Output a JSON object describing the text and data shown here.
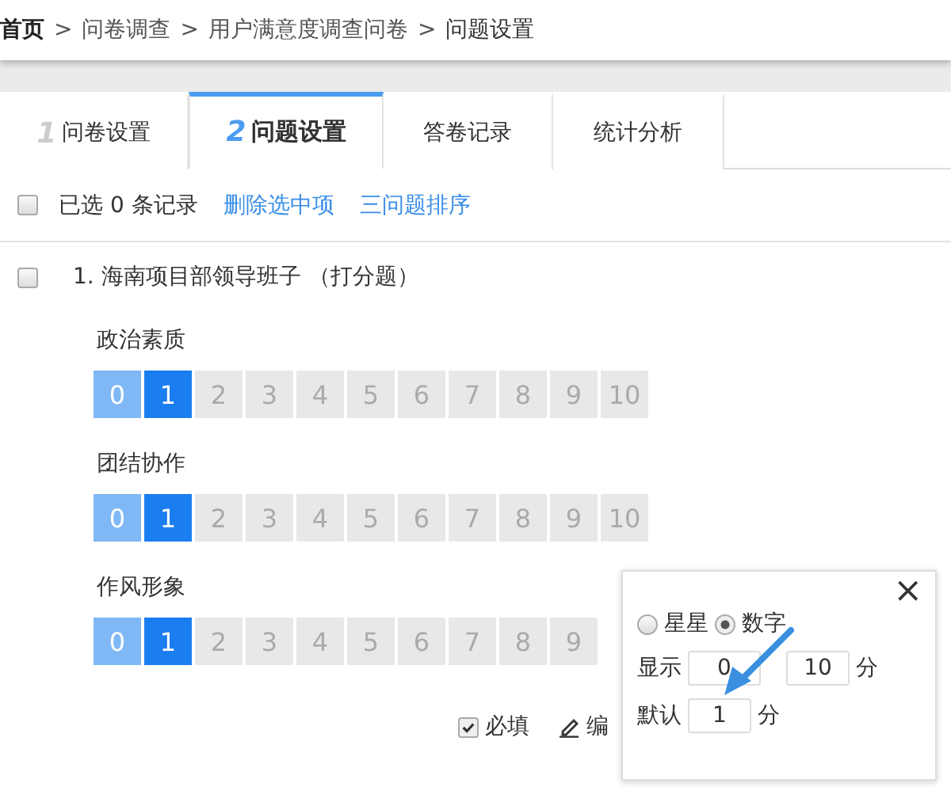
{
  "breadcrumb": [
    {
      "label": "首页",
      "kind": "home"
    },
    {
      "label": "问卷调查",
      "kind": "link"
    },
    {
      "label": "用户满意度调查问卷",
      "kind": "link"
    },
    {
      "label": "问题设置",
      "kind": "current"
    }
  ],
  "breadcrumb_separator": ">",
  "tabs": [
    {
      "number": "1",
      "label": "问卷设置",
      "selected": false
    },
    {
      "number": "2",
      "label": "问题设置",
      "selected": true
    },
    {
      "label": "答卷记录",
      "selected": false
    },
    {
      "label": "统计分析",
      "selected": false
    }
  ],
  "toolbar": {
    "select_all": {
      "checked": false
    },
    "count_text": "已选 0 条记录",
    "delete_link": "删除选中项",
    "sort_link": "三问题排序"
  },
  "question": {
    "checked": false,
    "title": "1. 海南项目部领导班子 （打分题）",
    "items": [
      {
        "label": "政治素质",
        "options": [
          {
            "label": "0",
            "selected": false
          },
          {
            "label": "1",
            "selected": true
          },
          {
            "label": "2",
            "selected": false
          },
          {
            "label": "3",
            "selected": false
          },
          {
            "label": "4",
            "selected": false
          },
          {
            "label": "5",
            "selected": false
          },
          {
            "label": "6",
            "selected": false
          },
          {
            "label": "7",
            "selected": false
          },
          {
            "label": "8",
            "selected": false
          },
          {
            "label": "9",
            "selected": false
          },
          {
            "label": "10",
            "selected": false
          }
        ]
      },
      {
        "label": "团结协作",
        "options": [
          {
            "label": "0",
            "selected": false
          },
          {
            "label": "1",
            "selected": true
          },
          {
            "label": "2",
            "selected": false
          },
          {
            "label": "3",
            "selected": false
          },
          {
            "label": "4",
            "selected": false
          },
          {
            "label": "5",
            "selected": false
          },
          {
            "label": "6",
            "selected": false
          },
          {
            "label": "7",
            "selected": false
          },
          {
            "label": "8",
            "selected": false
          },
          {
            "label": "9",
            "selected": false
          },
          {
            "label": "10",
            "selected": false
          }
        ]
      },
      {
        "label": "作风形象",
        "options": [
          {
            "label": "0",
            "selected": false
          },
          {
            "label": "1",
            "selected": true
          },
          {
            "label": "2",
            "selected": false
          },
          {
            "label": "3",
            "selected": false
          },
          {
            "label": "4",
            "selected": false
          },
          {
            "label": "5",
            "selected": false
          },
          {
            "label": "6",
            "selected": false
          },
          {
            "label": "7",
            "selected": false
          },
          {
            "label": "8",
            "selected": false
          },
          {
            "label": "9",
            "selected": false
          }
        ]
      }
    ],
    "required": {
      "label": "必填",
      "checked": true
    },
    "edit_label": "编"
  },
  "popup": {
    "close": "×",
    "modes": [
      {
        "label": "星星",
        "selected": false
      },
      {
        "label": "数字",
        "selected": true
      }
    ],
    "range_label": "显示",
    "range_min": "0",
    "range_max": "10",
    "range_unit": "分",
    "default_label": "默认",
    "default_value": "1",
    "default_unit": "分"
  }
}
